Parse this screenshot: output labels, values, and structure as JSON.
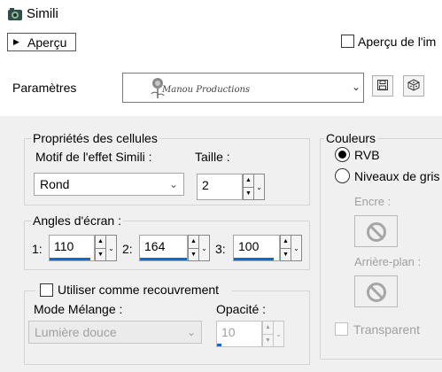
{
  "app": {
    "title": "Simili"
  },
  "preview": {
    "button_label": "Aperçu",
    "image_preview_label": "Aperçu de l'im"
  },
  "presets": {
    "label": "Paramètres",
    "watermark": "Manou Productions"
  },
  "cells": {
    "group_label": "Propriétés des cellules",
    "pattern_label": "Motif de l'effet Simili :",
    "pattern_value": "Rond",
    "size_label": "Taille :",
    "size_value": "2"
  },
  "angles": {
    "group_label": "Angles d'écran :",
    "items": [
      {
        "label": "1:",
        "value": "110"
      },
      {
        "label": "2:",
        "value": "164"
      },
      {
        "label": "3:",
        "value": "100"
      }
    ]
  },
  "overlay": {
    "checkbox_label": "Utiliser comme recouvrement",
    "blend_label": "Mode Mélange :",
    "blend_value": "Lumière douce",
    "opacity_label": "Opacité :",
    "opacity_value": "10"
  },
  "colors": {
    "group_label": "Couleurs",
    "rgb_label": "RVB",
    "grey_label": "Niveaux de gris",
    "ink_label": "Encre :",
    "background_label": "Arrière-plan :",
    "transparent_label": "Transparent",
    "accent": "#0a6cd6"
  }
}
